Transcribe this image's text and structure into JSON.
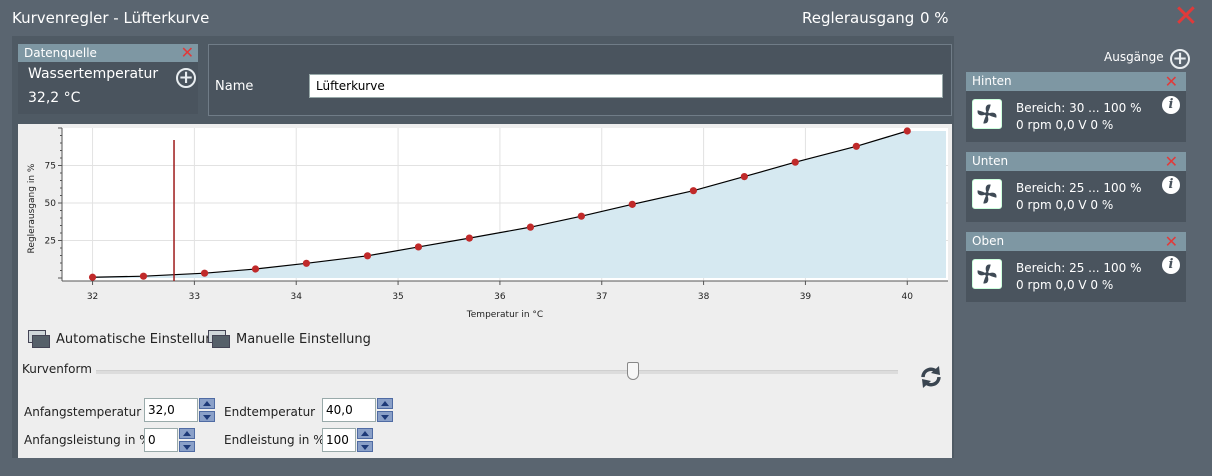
{
  "window": {
    "title": "Kurvenregler  -  Lüfterkurve",
    "regler_label": "Reglerausgang",
    "regler_value": "0 %"
  },
  "datasource": {
    "header": "Datenquelle",
    "name": "Wassertemperatur",
    "value": "32,2 °C"
  },
  "name_field": {
    "label": "Name",
    "value": "Lüfterkurve"
  },
  "chart_data": {
    "type": "line",
    "xlabel": "Temperatur in °C",
    "ylabel": "Reglerausgang in %",
    "xlim": [
      31.7,
      40.4
    ],
    "ylim": [
      -2,
      100
    ],
    "xticks": [
      "32",
      "33",
      "34",
      "35",
      "36",
      "37",
      "38",
      "39",
      "40"
    ],
    "yticks": [
      "25",
      "50",
      "75"
    ],
    "x": [
      32.0,
      32.5,
      33.1,
      33.6,
      34.1,
      34.7,
      35.2,
      35.7,
      36.3,
      36.8,
      37.3,
      37.9,
      38.4,
      38.9,
      39.5,
      40.0
    ],
    "y": [
      0.5,
      1.2,
      3.2,
      6.0,
      9.8,
      14.8,
      20.7,
      26.6,
      33.9,
      41.2,
      49.1,
      58.2,
      67.6,
      77.2,
      87.8,
      98.0
    ],
    "marker_x": 32.8,
    "colors": {
      "line": "#000000",
      "point": "#c02a2a",
      "fill": "#d6e9f1",
      "marker": "#9e1b1b"
    }
  },
  "buttons": {
    "auto": "Automatische Einstellung",
    "manual": "Manuelle Einstellung"
  },
  "curve": {
    "label": "Kurvenform",
    "value": 0.67
  },
  "fields": {
    "start_temp_label": "Anfangstemperatur",
    "start_temp": "32,0",
    "end_temp_label": "Endtemperatur",
    "end_temp": "40,0",
    "start_power_label": "Anfangsleistung in %",
    "start_power": "0",
    "end_power_label": "Endleistung in %",
    "end_power": "100"
  },
  "outputs": {
    "label": "Ausgänge",
    "items": [
      {
        "name": "Hinten",
        "range": "Bereich:  30 ... 100  %",
        "status": "0 rpm  0,0 V  0 %"
      },
      {
        "name": "Unten",
        "range": "Bereich:  25 ... 100  %",
        "status": "0 rpm  0,0 V  0 %"
      },
      {
        "name": "Oben",
        "range": "Bereich:  25 ... 100  %",
        "status": "0 rpm  0,0 V  0 %"
      }
    ]
  }
}
